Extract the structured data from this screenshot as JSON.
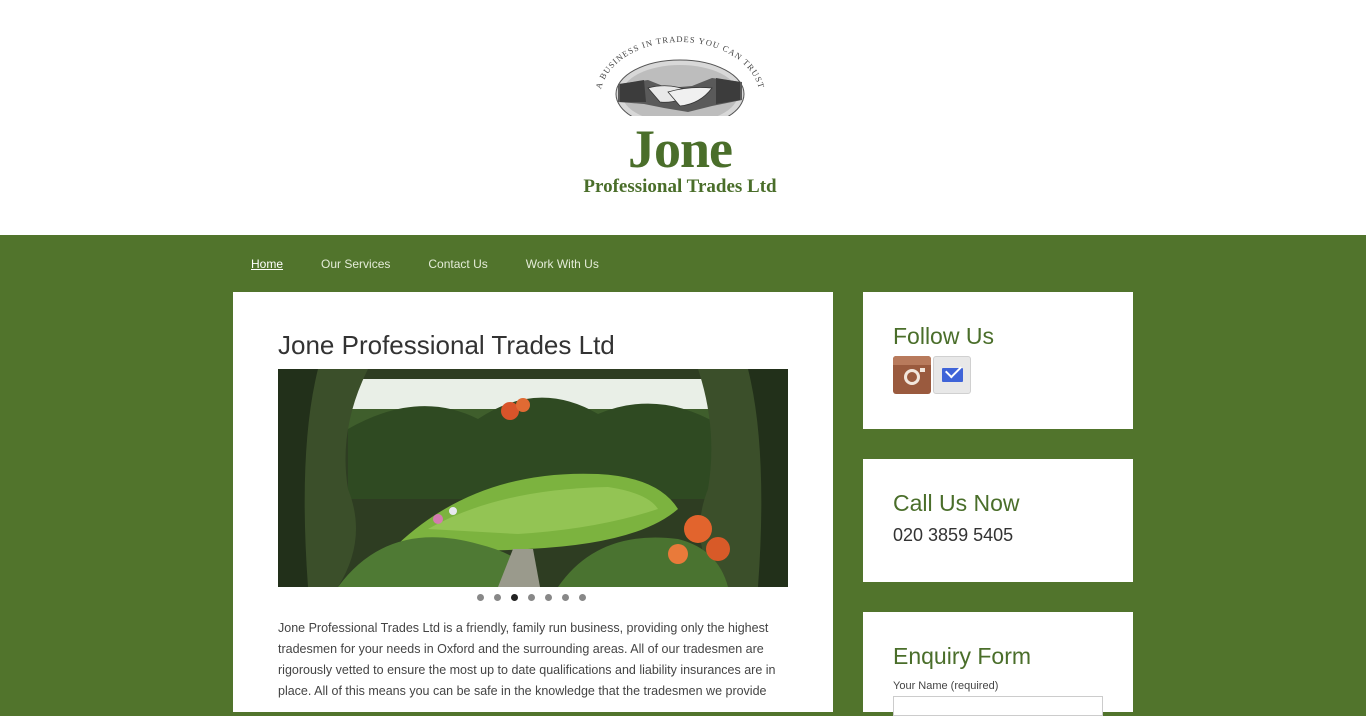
{
  "logo": {
    "arc_text": "A BUSINESS IN TRADES YOU CAN TRUST",
    "word": "Jone",
    "subtitle": "Professional Trades Ltd"
  },
  "nav": {
    "items": [
      {
        "label": "Home",
        "active": true
      },
      {
        "label": "Our Services",
        "active": false
      },
      {
        "label": "Contact Us",
        "active": false
      },
      {
        "label": "Work With Us",
        "active": false
      }
    ]
  },
  "main": {
    "title": "Jone Professional Trades Ltd",
    "slider": {
      "slides": 7,
      "active_index": 2
    },
    "intro": "Jone Professional Trades Ltd is a friendly, family run business, providing only the highest tradesmen for your needs in Oxford and the surrounding areas. All of our tradesmen are rigorously vetted to ensure the most up to date qualifications and liability insurances are in place. All of this means you can be safe in the knowledge that the tradesmen we provide"
  },
  "sidebar": {
    "follow": {
      "title": "Follow Us",
      "icons": [
        "instagram-icon",
        "email-icon"
      ]
    },
    "call": {
      "title": "Call Us Now",
      "phone": "020 3859 5405"
    },
    "enquiry": {
      "title": "Enquiry Form",
      "name_label": "Your Name (required)"
    }
  },
  "colors": {
    "brand_green": "#51742c",
    "title_green": "#4a6e2a"
  }
}
